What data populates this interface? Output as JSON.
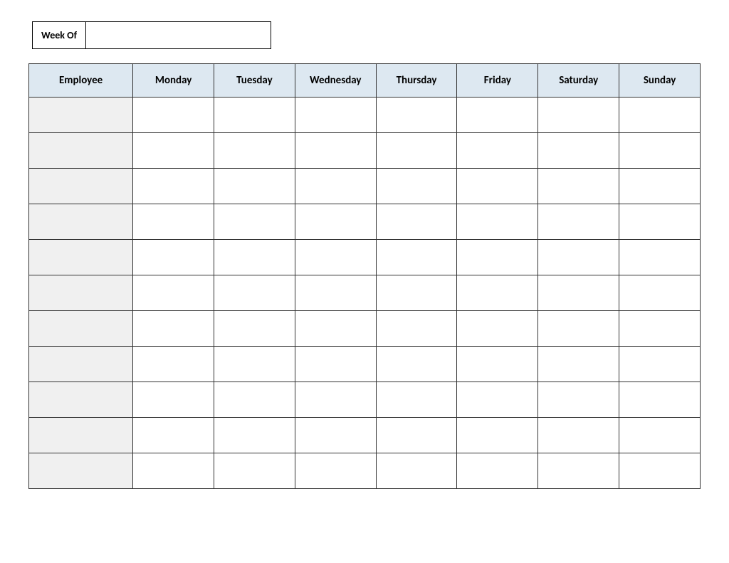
{
  "week_of": {
    "label": "Week Of",
    "value": ""
  },
  "table": {
    "headers": {
      "employee": "Employee",
      "days": [
        "Monday",
        "Tuesday",
        "Wednesday",
        "Thursday",
        "Friday",
        "Saturday",
        "Sunday"
      ]
    },
    "rows": [
      {
        "employee": "",
        "cells": [
          "",
          "",
          "",
          "",
          "",
          "",
          ""
        ]
      },
      {
        "employee": "",
        "cells": [
          "",
          "",
          "",
          "",
          "",
          "",
          ""
        ]
      },
      {
        "employee": "",
        "cells": [
          "",
          "",
          "",
          "",
          "",
          "",
          ""
        ]
      },
      {
        "employee": "",
        "cells": [
          "",
          "",
          "",
          "",
          "",
          "",
          ""
        ]
      },
      {
        "employee": "",
        "cells": [
          "",
          "",
          "",
          "",
          "",
          "",
          ""
        ]
      },
      {
        "employee": "",
        "cells": [
          "",
          "",
          "",
          "",
          "",
          "",
          ""
        ]
      },
      {
        "employee": "",
        "cells": [
          "",
          "",
          "",
          "",
          "",
          "",
          ""
        ]
      },
      {
        "employee": "",
        "cells": [
          "",
          "",
          "",
          "",
          "",
          "",
          ""
        ]
      },
      {
        "employee": "",
        "cells": [
          "",
          "",
          "",
          "",
          "",
          "",
          ""
        ]
      },
      {
        "employee": "",
        "cells": [
          "",
          "",
          "",
          "",
          "",
          "",
          ""
        ]
      },
      {
        "employee": "",
        "cells": [
          "",
          "",
          "",
          "",
          "",
          "",
          ""
        ]
      }
    ]
  }
}
